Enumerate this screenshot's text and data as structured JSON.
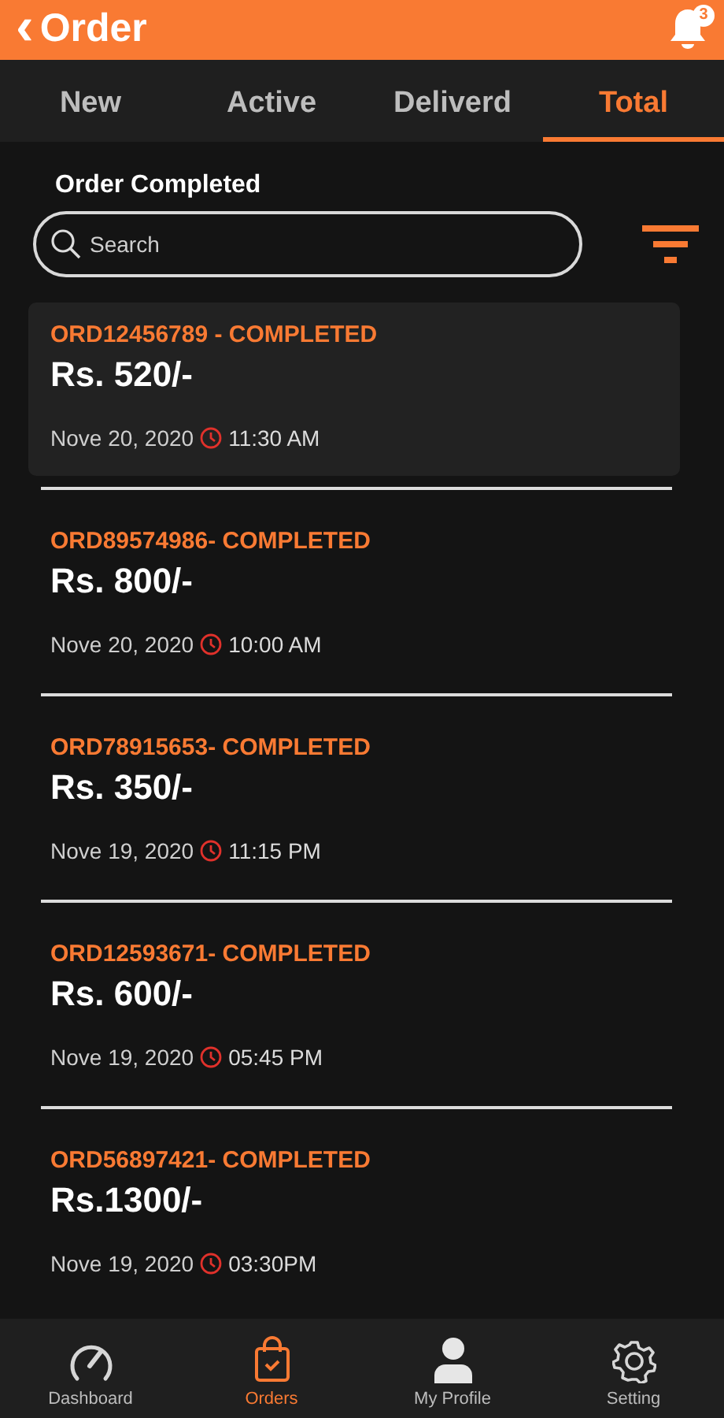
{
  "header": {
    "back": "‹",
    "title": "Order",
    "notification_count": "3"
  },
  "tabs": [
    {
      "label": "New",
      "selected": false
    },
    {
      "label": "Active",
      "selected": false
    },
    {
      "label": "Deliverd",
      "selected": false
    },
    {
      "label": "Total",
      "selected": true
    }
  ],
  "section_title": "Order Completed",
  "search": {
    "placeholder": "Search"
  },
  "orders": [
    {
      "title": "ORD12456789 - COMPLETED",
      "amount": "Rs. 520/-",
      "date": "Nove 20, 2020",
      "time": "11:30 AM",
      "selected": true
    },
    {
      "title": "ORD89574986- COMPLETED",
      "amount": "Rs. 800/-",
      "date": "Nove 20, 2020",
      "time": "10:00 AM",
      "selected": false
    },
    {
      "title": "ORD78915653- COMPLETED",
      "amount": "Rs. 350/-",
      "date": "Nove 19, 2020",
      "time": "11:15 PM",
      "selected": false
    },
    {
      "title": "ORD12593671- COMPLETED",
      "amount": "Rs. 600/-",
      "date": "Nove 19, 2020",
      "time": "05:45 PM",
      "selected": false
    },
    {
      "title": "ORD56897421- COMPLETED",
      "amount": "Rs.1300/-",
      "date": "Nove 19, 2020",
      "time": "03:30PM",
      "selected": false
    }
  ],
  "bottom_nav": [
    {
      "label": "Dashboard",
      "kind": "dashboard",
      "selected": false
    },
    {
      "label": "Orders",
      "kind": "orders",
      "selected": true
    },
    {
      "label": "My Profile",
      "kind": "profile",
      "selected": false
    },
    {
      "label": "Setting",
      "kind": "setting",
      "selected": false
    }
  ]
}
